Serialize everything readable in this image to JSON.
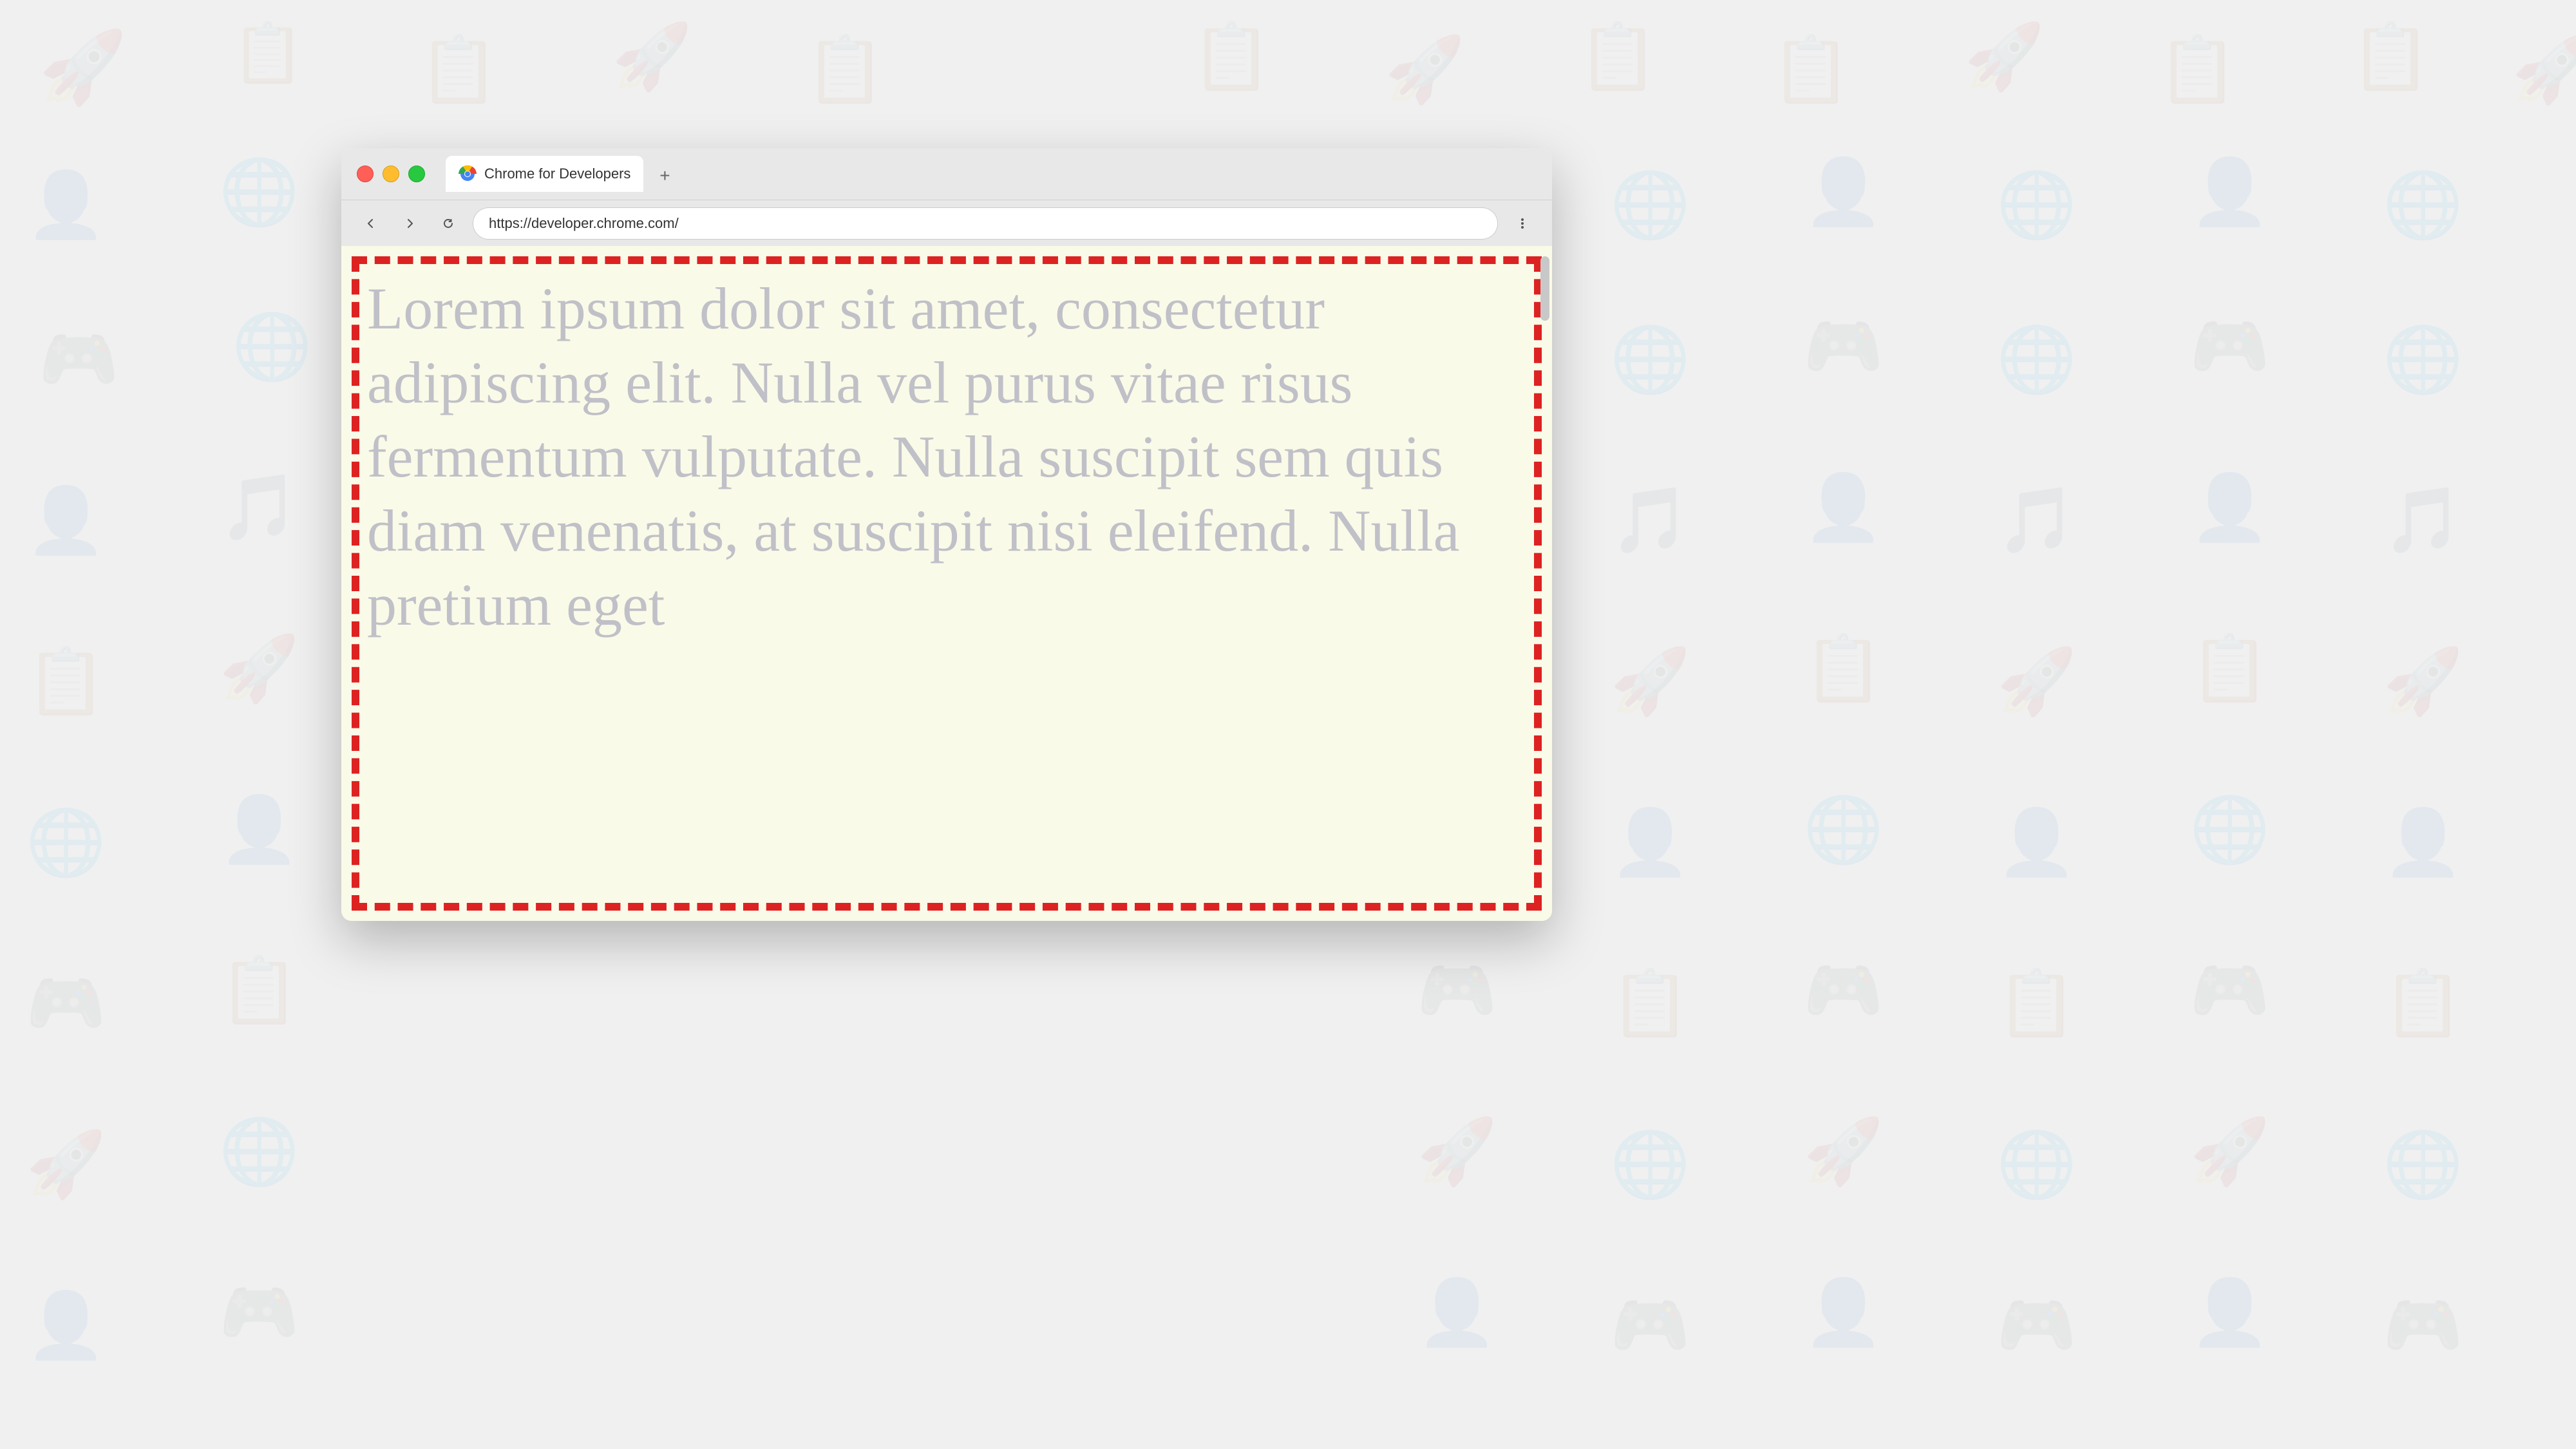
{
  "background": {
    "color": "#f0f0f0"
  },
  "browser": {
    "title_bar": {
      "tab": {
        "title": "Chrome for Developers",
        "favicon": "chrome-logo"
      },
      "new_tab_button": "+"
    },
    "nav_bar": {
      "back_button": "←",
      "forward_button": "→",
      "reload_button": "↻",
      "address": "https://developer.chrome.com/",
      "menu_button": "⋮"
    },
    "page": {
      "background_color": "#fafae8",
      "dashed_border_color": "#dd2222",
      "lorem_text": "Lorem ipsum dolor sit amet, consectetur adipiscing elit. Nulla vel purus vitae risus fermentum vulputate. Nulla suscipit sem quis diam venenatis, at suscipit nisi eleifend. Nulla pretium eget",
      "text_color": "#c0c0c8"
    }
  }
}
